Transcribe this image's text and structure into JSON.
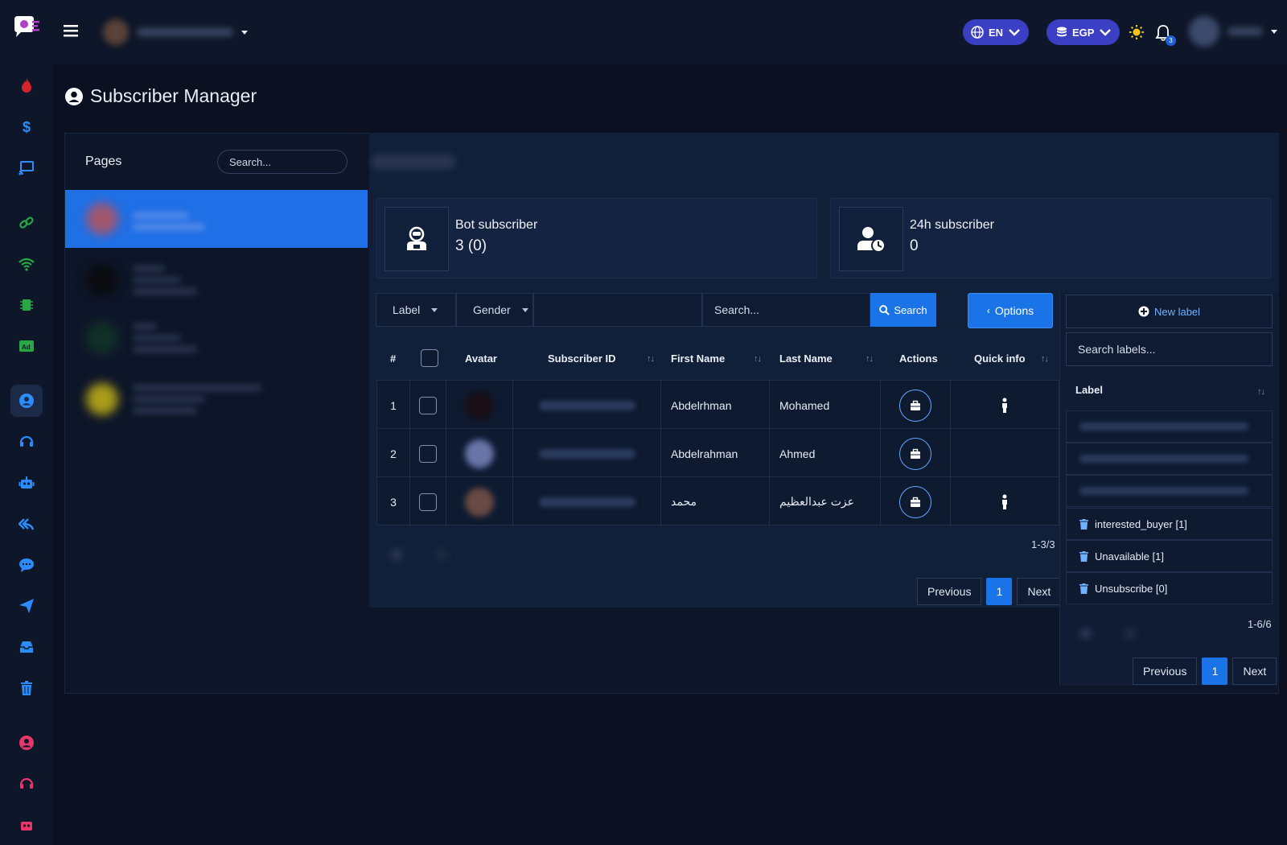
{
  "topbar": {
    "language": "EN",
    "currency": "EGP",
    "notification_count": "3"
  },
  "page": {
    "title": "Subscriber Manager"
  },
  "pages_panel": {
    "heading": "Pages",
    "search_placeholder": "Search..."
  },
  "stats": [
    {
      "title": "Bot subscriber",
      "value": "3 (0)"
    },
    {
      "title": "24h subscriber",
      "value": "0"
    }
  ],
  "filters": {
    "label_select": "Label",
    "gender_select": "Gender",
    "search_placeholder": "Search...",
    "search_button": "Search",
    "options_button": "Options"
  },
  "table": {
    "headers": {
      "num": "#",
      "avatar": "Avatar",
      "subscriber_id": "Subscriber ID",
      "first_name": "First Name",
      "last_name": "Last Name",
      "actions": "Actions",
      "quick_info": "Quick info"
    },
    "rows": [
      {
        "num": "1",
        "first_name": "Abdelrhman",
        "last_name": "Mohamed"
      },
      {
        "num": "2",
        "first_name": "Abdelrahman",
        "last_name": "Ahmed"
      },
      {
        "num": "3",
        "first_name": "محمد",
        "last_name": "عزت عبدالعظيم"
      }
    ],
    "range": "1-3/3",
    "pager": {
      "previous": "Previous",
      "current": "1",
      "next": "Next"
    }
  },
  "labels_panel": {
    "new_label": "New label",
    "search_placeholder": "Search labels...",
    "column_header": "Label",
    "items": [
      {
        "text": "interested_buyer [1]"
      },
      {
        "text": "Unavailable [1]"
      },
      {
        "text": "Unsubscribe [0]"
      }
    ],
    "range": "1-6/6",
    "pager": {
      "previous": "Previous",
      "current": "1",
      "next": "Next"
    }
  },
  "colors": {
    "background": "#0b1120",
    "accent": "#1a74e8",
    "pill": "#3b3fc4"
  }
}
